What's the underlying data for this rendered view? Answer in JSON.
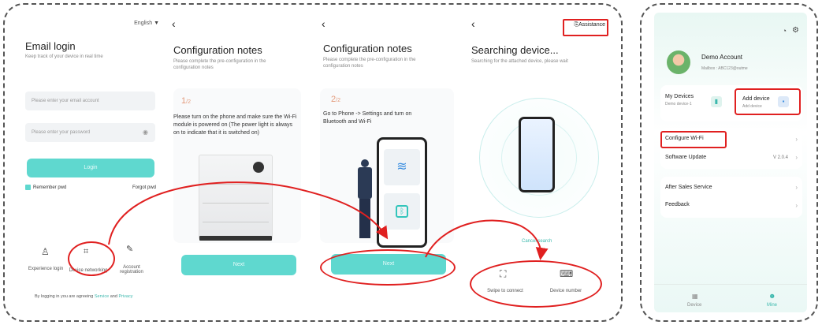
{
  "login": {
    "language": "English",
    "title": "Email login",
    "subtitle": "Keep track of your device in real time",
    "email_placeholder": "Please enter your email account",
    "password_placeholder": "Please enter your password",
    "login_label": "Login",
    "remember_label": "Remember pwd",
    "forgot_label": "Forgot pwd",
    "options": [
      "Experience login",
      "Device networking",
      "Account registration"
    ],
    "agree_text": "By logging in you are agreeing",
    "service_link": "Service",
    "and_text": "and",
    "privacy_link": "Privacy"
  },
  "config1": {
    "title": "Configuration notes",
    "subtitle": "Please complete the pre-configuration in the configuration notes",
    "step": "1",
    "total": "/2",
    "desc": "Please turn on the phone and make sure the Wi-Fi module is powered on (The power light is always on to indicate that it is switched on)",
    "next_label": "Next"
  },
  "config2": {
    "title": "Configuration notes",
    "subtitle": "Please complete the pre-configuration in the configuration notes",
    "step": "2",
    "total": "/2",
    "desc": "Go to Phone -> Settings and turn on Bluetooth and Wi-Fi",
    "next_label": "Next"
  },
  "search": {
    "assistance_label": "Assistance",
    "title": "Searching device...",
    "subtitle": "Searching for the attached device, please wait",
    "cancel_label": "Cancel search",
    "swipe_label": "Swipe to connect",
    "device_number_label": "Device number"
  },
  "mine": {
    "account_name": "Demo Account",
    "mailbox": "Mailbox : ABC123@outme",
    "my_devices_label": "My Devices",
    "my_devices_sub": "Demo device-1",
    "add_device_label": "Add device",
    "add_device_sub": "Add device",
    "menu": [
      {
        "label": "Configure Wi-Fi",
        "value": ""
      },
      {
        "label": "Software Update",
        "value": "V 2.0.4"
      },
      {
        "label": "After Sales Service",
        "value": ""
      },
      {
        "label": "Feedback",
        "value": ""
      }
    ],
    "tabs": [
      "Device",
      "Mine"
    ]
  },
  "colors": {
    "accent": "#5fd8cf",
    "highlight": "#e02020",
    "step": "#e39a7b"
  }
}
